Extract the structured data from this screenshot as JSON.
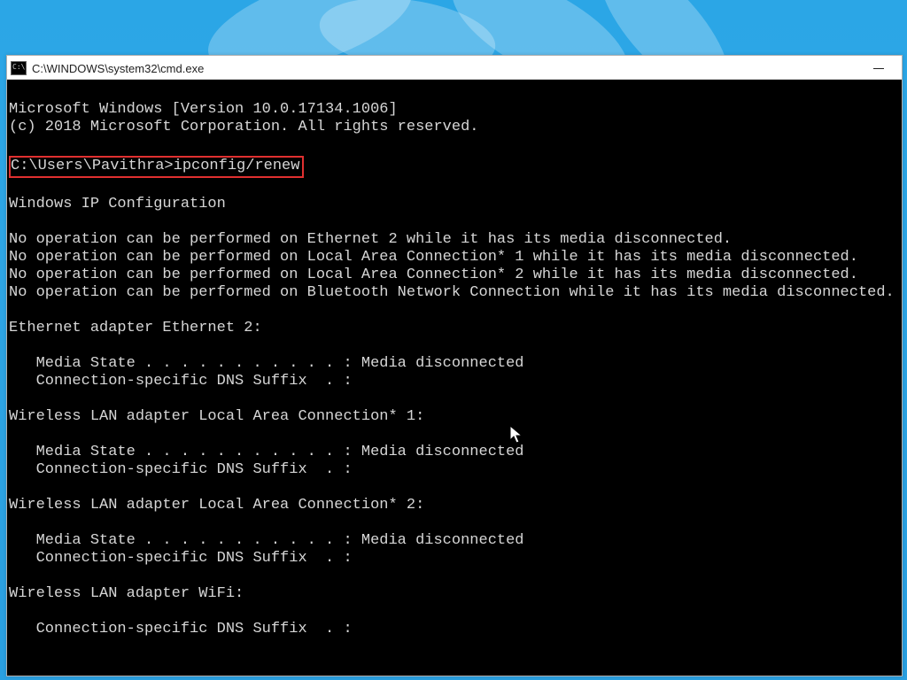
{
  "window": {
    "title": "C:\\WINDOWS\\system32\\cmd.exe"
  },
  "terminal": {
    "banner1": "Microsoft Windows [Version 10.0.17134.1006]",
    "banner2": "(c) 2018 Microsoft Corporation. All rights reserved.",
    "prompt_line": "C:\\Users\\Pavithra>ipconfig/renew",
    "hdr": "Windows IP Configuration",
    "noop1": "No operation can be performed on Ethernet 2 while it has its media disconnected.",
    "noop2": "No operation can be performed on Local Area Connection* 1 while it has its media disconnected.",
    "noop3": "No operation can be performed on Local Area Connection* 2 while it has its media disconnected.",
    "noop4": "No operation can be performed on Bluetooth Network Connection while it has its media disconnected.",
    "ad1": "Ethernet adapter Ethernet 2:",
    "ad1_ms": "   Media State . . . . . . . . . . . : Media disconnected",
    "ad1_dns": "   Connection-specific DNS Suffix  . :",
    "ad2": "Wireless LAN adapter Local Area Connection* 1:",
    "ad2_ms": "   Media State . . . . . . . . . . . : Media disconnected",
    "ad2_dns": "   Connection-specific DNS Suffix  . :",
    "ad3": "Wireless LAN adapter Local Area Connection* 2:",
    "ad3_ms": "   Media State . . . . . . . . . . . : Media disconnected",
    "ad3_dns": "   Connection-specific DNS Suffix  . :",
    "ad4": "Wireless LAN adapter WiFi:",
    "ad4_dns": "   Connection-specific DNS Suffix  . :"
  }
}
